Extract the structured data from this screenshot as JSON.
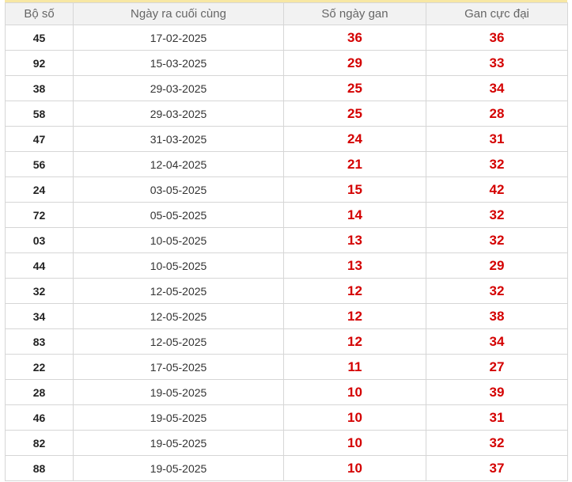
{
  "table": {
    "headers": [
      "Bộ số",
      "Ngày ra cuối cùng",
      "Số ngày gan",
      "Gan cực đại"
    ],
    "rows": [
      [
        "45",
        "17-02-2025",
        "36",
        "36"
      ],
      [
        "92",
        "15-03-2025",
        "29",
        "33"
      ],
      [
        "38",
        "29-03-2025",
        "25",
        "34"
      ],
      [
        "58",
        "29-03-2025",
        "25",
        "28"
      ],
      [
        "47",
        "31-03-2025",
        "24",
        "31"
      ],
      [
        "56",
        "12-04-2025",
        "21",
        "32"
      ],
      [
        "24",
        "03-05-2025",
        "15",
        "42"
      ],
      [
        "72",
        "05-05-2025",
        "14",
        "32"
      ],
      [
        "03",
        "10-05-2025",
        "13",
        "32"
      ],
      [
        "44",
        "10-05-2025",
        "13",
        "29"
      ],
      [
        "32",
        "12-05-2025",
        "12",
        "32"
      ],
      [
        "34",
        "12-05-2025",
        "12",
        "38"
      ],
      [
        "83",
        "12-05-2025",
        "12",
        "34"
      ],
      [
        "22",
        "17-05-2025",
        "11",
        "27"
      ],
      [
        "28",
        "19-05-2025",
        "10",
        "39"
      ],
      [
        "46",
        "19-05-2025",
        "10",
        "31"
      ],
      [
        "82",
        "19-05-2025",
        "10",
        "32"
      ],
      [
        "88",
        "19-05-2025",
        "10",
        "37"
      ]
    ]
  },
  "colors": {
    "header_bg": "#f2f2f2",
    "header_text": "#666666",
    "border": "#d6d6d6",
    "highlight_red": "#d40000",
    "top_accent": "#f7e7a4"
  }
}
